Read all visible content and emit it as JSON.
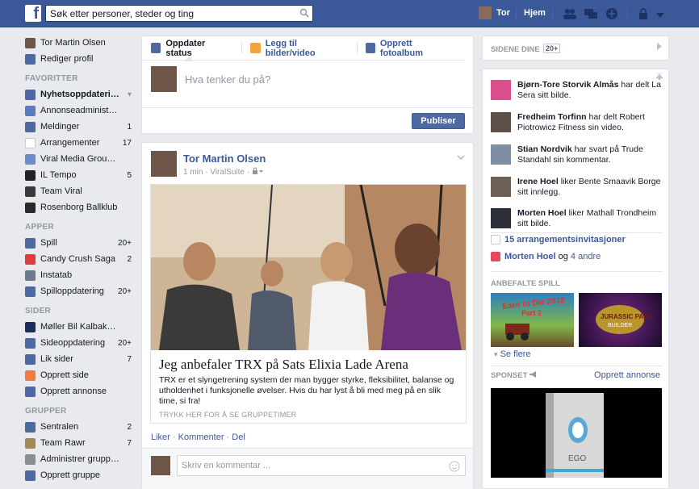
{
  "topbar": {
    "logo": "f",
    "search_placeholder": "Søk etter personer, steder og ting",
    "user_name": "Tor",
    "home_label": "Hjem"
  },
  "leftnav": {
    "profile_name": "Tor Martin Olsen",
    "edit_profile": "Rediger profil",
    "favorites_header": "FAVORITTER",
    "favorites": [
      {
        "label": "Nyhetsoppdatering",
        "count": "",
        "icon_color": "#4e69a2"
      },
      {
        "label": "Annonseadministra...",
        "count": "",
        "icon_color": "#5b7bc0"
      },
      {
        "label": "Meldinger",
        "count": "1",
        "icon_color": "#4e69a2"
      },
      {
        "label": "Arrangementer",
        "count": "17",
        "icon_color": "#ffffff"
      },
      {
        "label": "Viral Media Group AS",
        "count": "",
        "icon_color": "#6b8cc9"
      },
      {
        "label": "IL Tempo",
        "count": "5",
        "icon_color": "#222222"
      },
      {
        "label": "Team Viral",
        "count": "",
        "icon_color": "#3a3a3a"
      },
      {
        "label": "Rosenborg Ballklub",
        "count": "",
        "icon_color": "#2a2a2a"
      }
    ],
    "apps_header": "APPER",
    "apps": [
      {
        "label": "Spill",
        "count": "20+",
        "icon_color": "#4e69a2"
      },
      {
        "label": "Candy Crush Saga",
        "count": "2",
        "icon_color": "#e03a3a"
      },
      {
        "label": "Instatab",
        "count": "",
        "icon_color": "#6b7b8c"
      },
      {
        "label": "Spilloppdatering",
        "count": "20+",
        "icon_color": "#4e69a2"
      }
    ],
    "pages_header": "SIDER",
    "pages": [
      {
        "label": "Møller Bil Kalbakken",
        "count": "",
        "icon_color": "#1b2f5a"
      },
      {
        "label": "Sideoppdatering",
        "count": "20+",
        "icon_color": "#4e69a2"
      },
      {
        "label": "Lik sider",
        "count": "7",
        "icon_color": "#4e69a2"
      },
      {
        "label": "Opprett side",
        "count": "",
        "icon_color": "#f27b3d"
      },
      {
        "label": "Opprett annonse",
        "count": "",
        "icon_color": "#4e69a2"
      }
    ],
    "groups_header": "GRUPPER",
    "groups": [
      {
        "label": "Sentralen",
        "count": "2",
        "icon_color": "#4e69a2"
      },
      {
        "label": "Team Rawr",
        "count": "7",
        "icon_color": "#a08a5a"
      },
      {
        "label": "Administrer gruppe...",
        "count": "",
        "icon_color": "#8a8d91"
      },
      {
        "label": "Opprett gruppe",
        "count": "",
        "icon_color": "#4e69a2"
      }
    ]
  },
  "composer": {
    "tab_status": "Oppdater status",
    "tab_photo": "Legg til bilder/video",
    "tab_album": "Opprett fotoalbum",
    "placeholder": "Hva tenker du på?",
    "publish": "Publiser"
  },
  "post": {
    "author": "Tor Martin Olsen",
    "meta": "1 min · ViralSuite · ",
    "attachment_title": "Jeg anbefaler TRX på Sats Elixia Lade Arena",
    "attachment_desc": "TRX er et slyngetrening system der man bygger styrke, fleksibilitet, balanse og utholdenhet i funksjonelle øvelser. Hvis du har lyst å bli med meg på en slik time, si fra!",
    "attachment_cta": "TRYKK HER FOR Å SE GRUPPETIMER",
    "action_like": "Liker",
    "action_comment": "Kommenter",
    "action_share": "Del",
    "comment_placeholder": "Skriv en kommentar ..."
  },
  "right": {
    "pages_title": "SIDENE DINE",
    "pages_badge": "20+",
    "ticker": [
      {
        "name": "Bjørn-Tore Storvik Almås",
        "text": " har delt La Sera sitt bilde.",
        "color": "#d94f8c"
      },
      {
        "name": "Fredheim Torfinn",
        "text": " har delt Robert Piotrowicz Fitness sin video.",
        "color": "#5c5048"
      },
      {
        "name": "Stian Nordvik",
        "text": " har svart på Trude Standahl sin kommentar.",
        "color": "#7d8fa3"
      },
      {
        "name": "Irene Hoel",
        "text": " liker Bente Smaavik Borge sitt innlegg.",
        "color": "#6b5f56"
      },
      {
        "name": "Morten Hoel",
        "text": " liker Mathall Trondheim sitt bilde.",
        "color": "#2c2f3a"
      }
    ],
    "invites": "15 arrangementsinvitasjoner",
    "birthday_name": "Morten Hoel",
    "birthday_connector": " og ",
    "birthday_others": "4 andre",
    "games_title": "ANBEFALTE SPILL",
    "see_more": "Se flere",
    "sponsored_title": "SPONSET",
    "create_ad": "Opprett annonse"
  }
}
